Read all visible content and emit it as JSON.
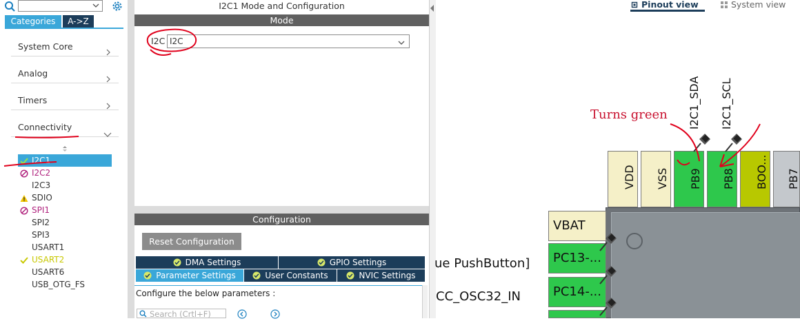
{
  "left": {
    "tabs": {
      "categories": "Categories",
      "atoz": "A->Z"
    },
    "categories": [
      {
        "label": "System Core",
        "expanded": false
      },
      {
        "label": "Analog",
        "expanded": false
      },
      {
        "label": "Timers",
        "expanded": false
      },
      {
        "label": "Connectivity",
        "expanded": true
      }
    ],
    "peripherals": [
      {
        "label": "I2C1",
        "status": "ok",
        "selected": true
      },
      {
        "label": "I2C2",
        "status": "disabled"
      },
      {
        "label": "I2C3",
        "status": "none"
      },
      {
        "label": "SDIO",
        "status": "warning"
      },
      {
        "label": "SPI1",
        "status": "disabled"
      },
      {
        "label": "SPI2",
        "status": "none"
      },
      {
        "label": "SPI3",
        "status": "none"
      },
      {
        "label": "USART1",
        "status": "none"
      },
      {
        "label": "USART2",
        "status": "ok-yellow"
      },
      {
        "label": "USART6",
        "status": "none"
      },
      {
        "label": "USB_OTG_FS",
        "status": "none"
      }
    ]
  },
  "middle": {
    "title": "I2C1 Mode and Configuration",
    "mode_bar": "Mode",
    "i2c_label": "I2C",
    "i2c_value": "I2C",
    "config_bar": "Configuration",
    "reset_button": "Reset Configuration",
    "tabs_row1": [
      "DMA Settings",
      "GPIO Settings"
    ],
    "tabs_row2": [
      "Parameter Settings",
      "User Constants",
      "NVIC Settings"
    ],
    "configure_text": "Configure the below parameters :",
    "search_placeholder": "Search (Crtl+F)"
  },
  "right": {
    "view_tabs": {
      "pinout": "Pinout view",
      "system": "System view"
    },
    "signal_labels": [
      "I2C1_SDA",
      "I2C1_SCL"
    ],
    "top_pins": [
      "VDD",
      "VSS",
      "PB9",
      "PB8",
      "BOO...",
      "PB7"
    ],
    "left_pins": [
      "VBAT",
      "PC13-...",
      "PC14-..."
    ],
    "pin_side_labels": [
      "ue PushButton]",
      "CC_OSC32_IN"
    ],
    "annotation": "Turns green"
  },
  "colors": {
    "accent": "#3aa7d9",
    "dark_tab": "#1c3d5a",
    "pin_green": "#2ec84c",
    "pin_power": "#f5f0c8",
    "annotation_red": "#c8102e"
  }
}
